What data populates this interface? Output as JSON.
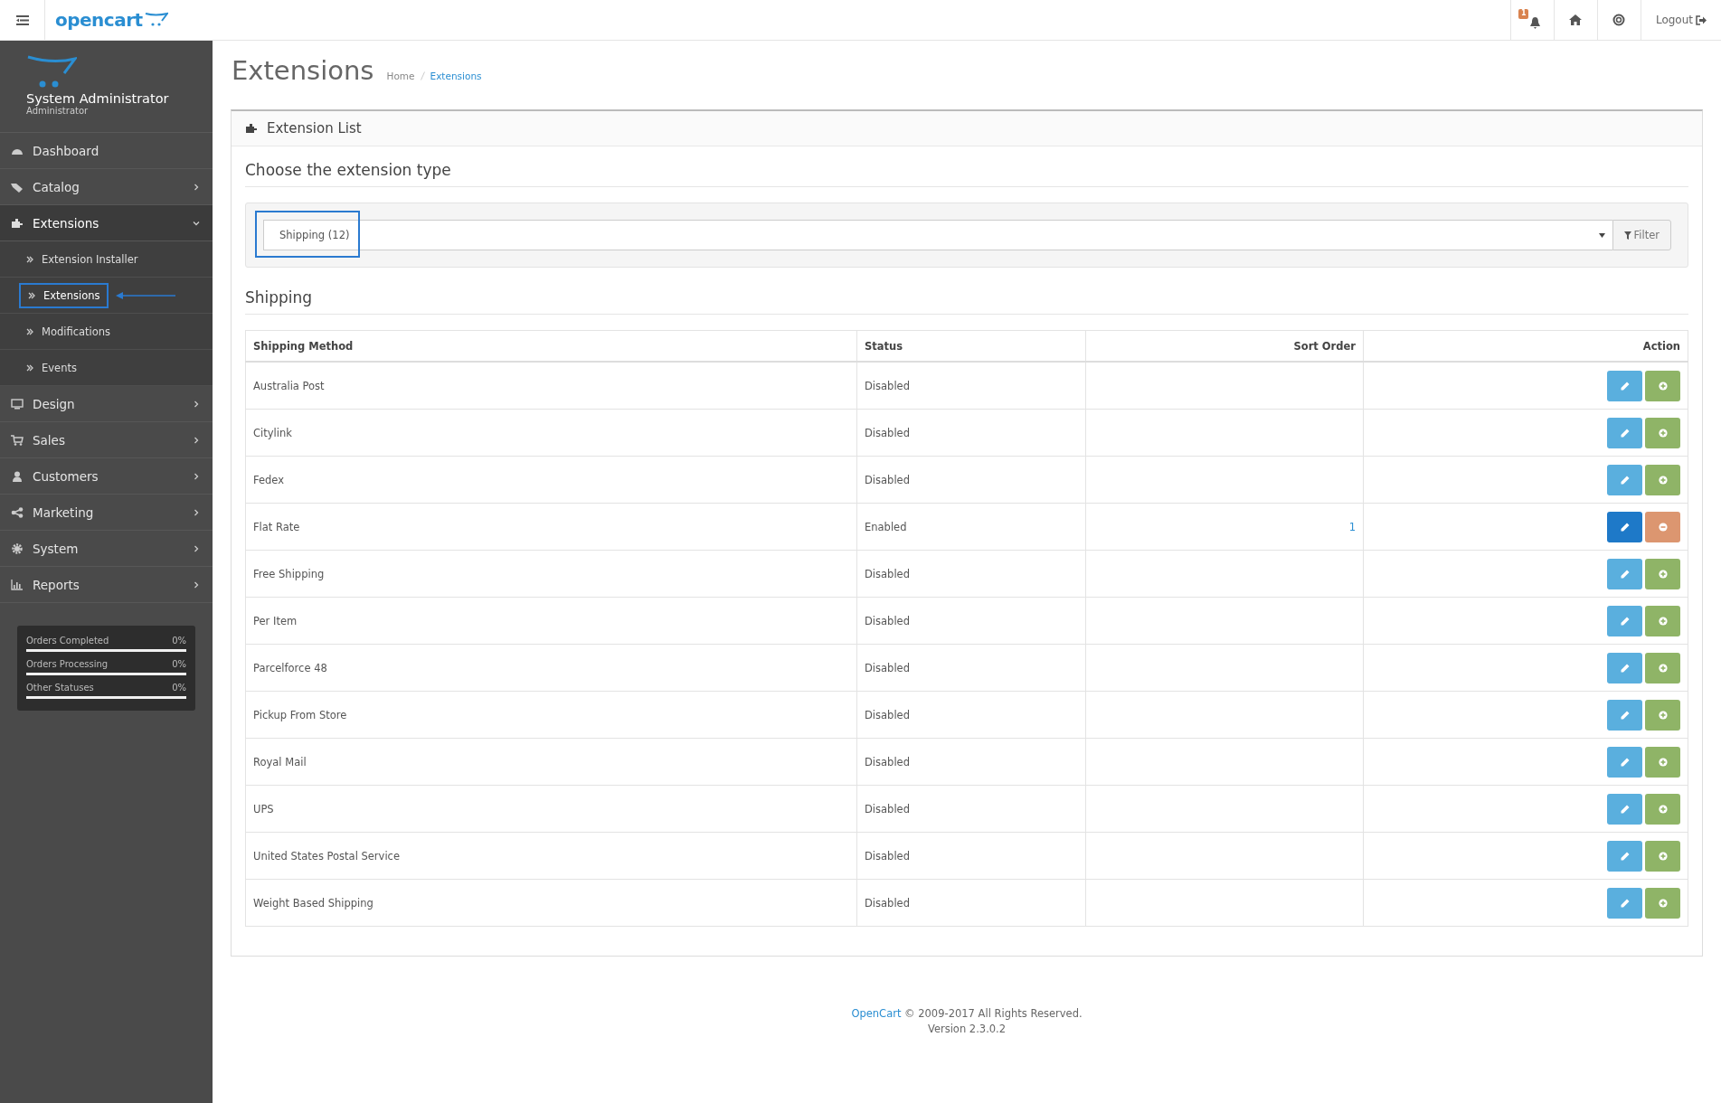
{
  "header": {
    "logo": "opencart",
    "notification_count": "1",
    "logout": "Logout"
  },
  "sidebar": {
    "user_name": "System Administrator",
    "user_role": "Administrator",
    "menu": [
      {
        "label": "Dashboard",
        "has_children": false,
        "expanded": false
      },
      {
        "label": "Catalog",
        "has_children": true,
        "expanded": false
      },
      {
        "label": "Extensions",
        "has_children": true,
        "expanded": true,
        "children": [
          {
            "label": "Extension Installer",
            "selected": false,
            "highlighted": false
          },
          {
            "label": "Extensions",
            "selected": true,
            "highlighted": true
          },
          {
            "label": "Modifications",
            "selected": false,
            "highlighted": false
          },
          {
            "label": "Events",
            "selected": false,
            "highlighted": false
          }
        ]
      },
      {
        "label": "Design",
        "has_children": true,
        "expanded": false
      },
      {
        "label": "Sales",
        "has_children": true,
        "expanded": false
      },
      {
        "label": "Customers",
        "has_children": true,
        "expanded": false
      },
      {
        "label": "Marketing",
        "has_children": true,
        "expanded": false
      },
      {
        "label": "System",
        "has_children": true,
        "expanded": false
      },
      {
        "label": "Reports",
        "has_children": true,
        "expanded": false
      }
    ],
    "stats": [
      {
        "label": "Orders Completed",
        "value": "0%",
        "level": 0
      },
      {
        "label": "Orders Processing",
        "value": "0%",
        "level": 0
      },
      {
        "label": "Other Statuses",
        "value": "0%",
        "level": 0
      }
    ]
  },
  "page": {
    "title": "Extensions",
    "breadcrumb": [
      {
        "label": "Home",
        "current": false
      },
      {
        "label": "Extensions",
        "current": true
      }
    ]
  },
  "panel": {
    "title": "Extension List",
    "type_heading": "Choose the extension type",
    "select": {
      "value": "Shipping (12)",
      "highlighted": true
    },
    "filter_button": "Filter",
    "section_heading": "Shipping",
    "table": {
      "columns": [
        "Shipping Method",
        "Status",
        "Sort Order",
        "Action"
      ],
      "rows": [
        {
          "name": "Australia Post",
          "status": "Disabled",
          "sort_order": "",
          "installed": false
        },
        {
          "name": "Citylink",
          "status": "Disabled",
          "sort_order": "",
          "installed": false
        },
        {
          "name": "Fedex",
          "status": "Disabled",
          "sort_order": "",
          "installed": false
        },
        {
          "name": "Flat Rate",
          "status": "Enabled",
          "sort_order": "1",
          "installed": true
        },
        {
          "name": "Free Shipping",
          "status": "Disabled",
          "sort_order": "",
          "installed": false
        },
        {
          "name": "Per Item",
          "status": "Disabled",
          "sort_order": "",
          "installed": false
        },
        {
          "name": "Parcelforce 48",
          "status": "Disabled",
          "sort_order": "",
          "installed": false
        },
        {
          "name": "Pickup From Store",
          "status": "Disabled",
          "sort_order": "",
          "installed": false
        },
        {
          "name": "Royal Mail",
          "status": "Disabled",
          "sort_order": "",
          "installed": false
        },
        {
          "name": "UPS",
          "status": "Disabled",
          "sort_order": "",
          "installed": false
        },
        {
          "name": "United States Postal Service",
          "status": "Disabled",
          "sort_order": "",
          "installed": false
        },
        {
          "name": "Weight Based Shipping",
          "status": "Disabled",
          "sort_order": "",
          "installed": false
        }
      ]
    }
  },
  "footer": {
    "link": "OpenCart",
    "text": "© 2009-2017 All Rights Reserved.",
    "version": "Version 2.3.0.2"
  }
}
